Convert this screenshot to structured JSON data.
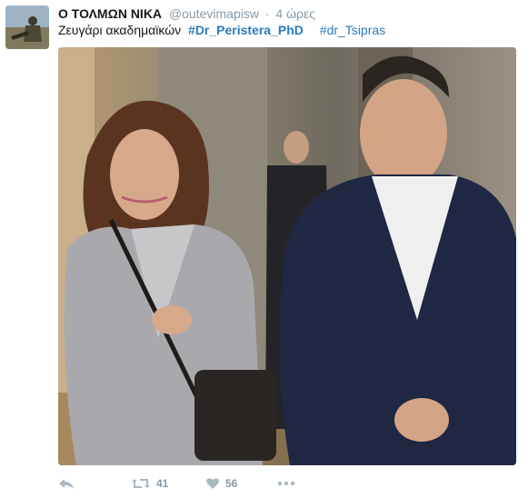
{
  "tweet": {
    "display_name": "Ο ΤΟΛΜΩΝ ΝΙΚΑ",
    "handle": "@outevimapisw",
    "separator": "·",
    "time": "4 ώρες",
    "text": "Ζευγάρι ακαδημαϊκών",
    "hashtags": [
      "#Dr_Peristera_PhD",
      "#dr_Tsipras"
    ]
  },
  "actions": {
    "retweet_count": "41",
    "like_count": "56"
  },
  "colors": {
    "link": "#2b7bb9",
    "muted": "#8899a6"
  },
  "icons": [
    "reply-icon",
    "retweet-icon",
    "heart-icon",
    "more-icon"
  ]
}
